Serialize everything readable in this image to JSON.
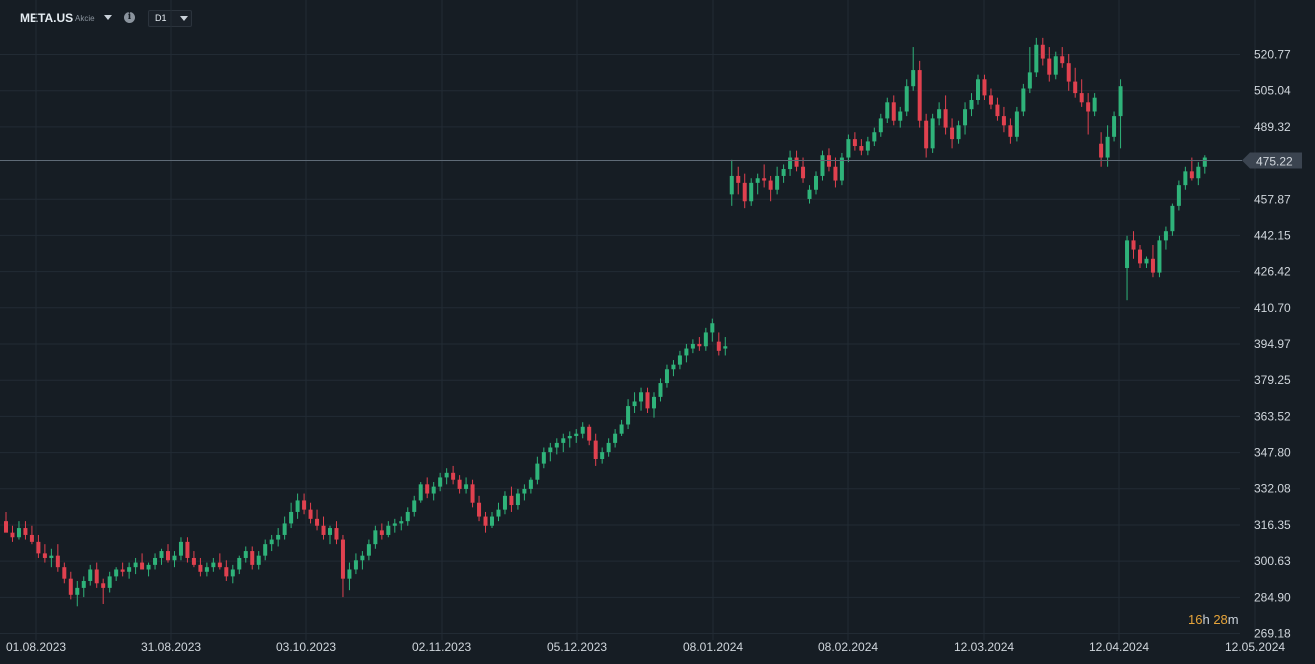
{
  "toolbar": {
    "symbol": "META.US",
    "type": "Akcie",
    "info_icon": "info-icon",
    "timeframe": "D1",
    "dropdown_icon": "chevron-down-icon"
  },
  "countdown": {
    "hours": "16",
    "h": "h",
    "minutes": "28",
    "m": "m"
  },
  "colors": {
    "up": "#2fb37a",
    "down": "#e0414f",
    "background": "#161d24",
    "grid": "#222b34",
    "price_line": "#5f6b77"
  },
  "chart_data": {
    "type": "candlestick",
    "symbol": "META.US",
    "timeframe": "D1",
    "y_ticks": [
      520.77,
      505.04,
      489.32,
      475.22,
      457.87,
      442.15,
      426.42,
      410.7,
      394.97,
      379.25,
      363.52,
      347.8,
      332.08,
      316.35,
      300.63,
      284.9,
      269.18
    ],
    "y_tick_labels": [
      "520.77",
      "505.04",
      "489.32",
      "475.22",
      "457.87",
      "442.15",
      "426.42",
      "410.70",
      "394.97",
      "379.25",
      "363.52",
      "347.80",
      "332.08",
      "316.35",
      "300.63",
      "284.90",
      "269.18"
    ],
    "ylim": [
      269.18,
      520.77
    ],
    "x_ticks": [
      "01.08.2023",
      "31.08.2023",
      "03.10.2023",
      "02.11.2023",
      "05.12.2023",
      "08.01.2024",
      "08.02.2024",
      "12.03.2024",
      "12.04.2024",
      "12.05.2024"
    ],
    "current_price": 475.22,
    "current_price_label": "475.22",
    "candles": [
      [
        318.0,
        322.0,
        316.0,
        313.0
      ],
      [
        313.0,
        316.0,
        309.0,
        311.0
      ],
      [
        311.0,
        318.0,
        310.0,
        315.0
      ],
      [
        315.0,
        318.0,
        310.0,
        312.0
      ],
      [
        312.0,
        316.0,
        308.0,
        309.0
      ],
      [
        309.0,
        312.0,
        302.0,
        304.0
      ],
      [
        304.0,
        308.0,
        300.0,
        302.0
      ],
      [
        302.0,
        306.0,
        298.0,
        303.0
      ],
      [
        303.0,
        308.0,
        296.0,
        298.0
      ],
      [
        298.0,
        300.0,
        291.0,
        293.0
      ],
      [
        293.0,
        296.0,
        284.0,
        286.0
      ],
      [
        286.0,
        292.0,
        281.0,
        289.0
      ],
      [
        289.0,
        294.0,
        285.0,
        292.0
      ],
      [
        292.0,
        299.0,
        290.0,
        297.0
      ],
      [
        297.0,
        300.0,
        289.0,
        291.0
      ],
      [
        291.0,
        293.0,
        282.0,
        289.0
      ],
      [
        289.0,
        296.0,
        287.0,
        294.0
      ],
      [
        294.0,
        298.0,
        292.0,
        297.0
      ],
      [
        297.0,
        300.0,
        294.0,
        296.0
      ],
      [
        296.0,
        300.0,
        293.0,
        298.0
      ],
      [
        298.0,
        302.0,
        295.0,
        300.0
      ],
      [
        300.0,
        304.0,
        297.0,
        297.0
      ],
      [
        297.0,
        300.0,
        294.0,
        299.0
      ],
      [
        299.0,
        304.0,
        297.0,
        302.0
      ],
      [
        302.0,
        306.0,
        299.0,
        305.0
      ],
      [
        305.0,
        308.0,
        300.0,
        301.0
      ],
      [
        301.0,
        305.0,
        298.0,
        303.0
      ],
      [
        303.0,
        311.0,
        301.0,
        309.0
      ],
      [
        309.0,
        311.0,
        300.0,
        302.0
      ],
      [
        302.0,
        305.0,
        298.0,
        299.0
      ],
      [
        299.0,
        302.0,
        294.0,
        296.0
      ],
      [
        296.0,
        300.0,
        294.0,
        298.0
      ],
      [
        298.0,
        302.0,
        296.0,
        300.0
      ],
      [
        300.0,
        304.0,
        297.0,
        298.0
      ],
      [
        298.0,
        301.0,
        292.0,
        294.0
      ],
      [
        294.0,
        299.0,
        291.0,
        297.0
      ],
      [
        297.0,
        303.0,
        295.0,
        302.0
      ],
      [
        302.0,
        307.0,
        300.0,
        305.0
      ],
      [
        305.0,
        307.0,
        297.0,
        299.0
      ],
      [
        299.0,
        305.0,
        297.0,
        303.0
      ],
      [
        303.0,
        310.0,
        301.0,
        308.0
      ],
      [
        308.0,
        312.0,
        305.0,
        310.0
      ],
      [
        310.0,
        315.0,
        307.0,
        312.0
      ],
      [
        312.0,
        320.0,
        310.0,
        317.0
      ],
      [
        317.0,
        326.0,
        315.0,
        322.0
      ],
      [
        322.0,
        330.0,
        319.0,
        327.0
      ],
      [
        327.0,
        330.0,
        321.0,
        323.0
      ],
      [
        323.0,
        326.0,
        317.0,
        319.0
      ],
      [
        319.0,
        323.0,
        314.0,
        316.0
      ],
      [
        316.0,
        320.0,
        310.0,
        312.0
      ],
      [
        312.0,
        316.0,
        308.0,
        315.0
      ],
      [
        315.0,
        318.0,
        308.0,
        310.0
      ],
      [
        310.0,
        312.0,
        285.0,
        293.0
      ],
      [
        293.0,
        300.0,
        288.0,
        297.0
      ],
      [
        297.0,
        304.0,
        295.0,
        301.0
      ],
      [
        301.0,
        305.0,
        297.0,
        303.0
      ],
      [
        303.0,
        310.0,
        301.0,
        308.0
      ],
      [
        308.0,
        316.0,
        306.0,
        314.0
      ],
      [
        314.0,
        317.0,
        310.0,
        312.0
      ],
      [
        312.0,
        318.0,
        311.0,
        316.0
      ],
      [
        316.0,
        319.0,
        313.0,
        317.0
      ],
      [
        317.0,
        320.0,
        314.0,
        318.0
      ],
      [
        318.0,
        324.0,
        316.0,
        322.0
      ],
      [
        322.0,
        329.0,
        320.0,
        327.0
      ],
      [
        327.0,
        335.0,
        326.0,
        334.0
      ],
      [
        334.0,
        337.0,
        328.0,
        330.0
      ],
      [
        330.0,
        335.0,
        327.0,
        333.0
      ],
      [
        333.0,
        339.0,
        331.0,
        337.0
      ],
      [
        337.0,
        341.0,
        334.0,
        339.0
      ],
      [
        339.0,
        342.0,
        334.0,
        336.0
      ],
      [
        336.0,
        338.0,
        330.0,
        332.0
      ],
      [
        332.0,
        337.0,
        330.0,
        334.0
      ],
      [
        334.0,
        336.0,
        324.0,
        326.0
      ],
      [
        326.0,
        329.0,
        318.0,
        320.0
      ],
      [
        320.0,
        322.0,
        313.0,
        316.0
      ],
      [
        316.0,
        322.0,
        315.0,
        320.0
      ],
      [
        320.0,
        326.0,
        318.0,
        323.0
      ],
      [
        323.0,
        331.0,
        321.0,
        329.0
      ],
      [
        329.0,
        333.0,
        322.0,
        325.0
      ],
      [
        325.0,
        332.0,
        323.0,
        330.0
      ],
      [
        330.0,
        334.0,
        327.0,
        332.0
      ],
      [
        332.0,
        337.0,
        330.0,
        336.0
      ],
      [
        336.0,
        346.0,
        334.0,
        343.0
      ],
      [
        343.0,
        350.0,
        341.0,
        348.0
      ],
      [
        348.0,
        352.0,
        344.0,
        350.0
      ],
      [
        350.0,
        354.0,
        347.0,
        352.0
      ],
      [
        352.0,
        356.0,
        348.0,
        354.0
      ],
      [
        354.0,
        357.0,
        350.0,
        355.0
      ],
      [
        355.0,
        358.0,
        352.0,
        356.0
      ],
      [
        356.0,
        361.0,
        354.0,
        359.0
      ],
      [
        359.0,
        360.0,
        351.0,
        353.0
      ],
      [
        353.0,
        356.0,
        342.0,
        345.0
      ],
      [
        345.0,
        350.0,
        343.0,
        348.0
      ],
      [
        348.0,
        354.0,
        346.0,
        352.0
      ],
      [
        352.0,
        358.0,
        350.0,
        356.0
      ],
      [
        356.0,
        362.0,
        355.0,
        360.0
      ],
      [
        360.0,
        371.0,
        358.0,
        368.0
      ],
      [
        368.0,
        374.0,
        365.0,
        370.0
      ],
      [
        370.0,
        376.0,
        366.0,
        374.0
      ],
      [
        374.0,
        376.0,
        365.0,
        367.0
      ],
      [
        367.0,
        374.0,
        363.0,
        372.0
      ],
      [
        372.0,
        380.0,
        370.0,
        378.0
      ],
      [
        378.0,
        386.0,
        376.0,
        384.0
      ],
      [
        384.0,
        388.0,
        381.0,
        386.0
      ],
      [
        386.0,
        392.0,
        384.0,
        390.0
      ],
      [
        390.0,
        395.0,
        387.0,
        393.0
      ],
      [
        393.0,
        397.0,
        391.0,
        395.0
      ],
      [
        395.0,
        398.0,
        392.0,
        394.0
      ],
      [
        394.0,
        402.0,
        392.0,
        400.0
      ],
      [
        400.0,
        406.0,
        396.0,
        404.0
      ],
      [
        396.0,
        400.0,
        390.0,
        392.0
      ],
      [
        393.0,
        398.0,
        390.0,
        394.0
      ],
      [
        460.0,
        475.0,
        455.0,
        468.0
      ],
      [
        468.0,
        472.0,
        460.0,
        465.0
      ],
      [
        465.0,
        469.0,
        454.0,
        457.0
      ],
      [
        457.0,
        467.0,
        455.0,
        465.0
      ],
      [
        465.0,
        469.0,
        460.0,
        467.0
      ],
      [
        467.0,
        473.0,
        463.0,
        466.0
      ],
      [
        466.0,
        468.0,
        457.0,
        462.0
      ],
      [
        462.0,
        472.0,
        460.0,
        468.0
      ],
      [
        468.0,
        473.0,
        465.0,
        471.0
      ],
      [
        471.0,
        479.0,
        468.0,
        476.0
      ],
      [
        476.0,
        479.0,
        470.0,
        472.0
      ],
      [
        472.0,
        476.0,
        465.0,
        467.0
      ],
      [
        458.0,
        464.0,
        456.0,
        462.0
      ],
      [
        462.0,
        470.0,
        460.0,
        468.0
      ],
      [
        468.0,
        479.0,
        466.0,
        477.0
      ],
      [
        477.0,
        480.0,
        470.0,
        472.0
      ],
      [
        472.0,
        476.0,
        463.0,
        466.0
      ],
      [
        466.0,
        478.0,
        464.0,
        476.0
      ],
      [
        476.0,
        486.0,
        474.0,
        484.0
      ],
      [
        484.0,
        487.0,
        479.0,
        481.0
      ],
      [
        481.0,
        484.0,
        477.0,
        479.0
      ],
      [
        479.0,
        485.0,
        477.0,
        483.0
      ],
      [
        483.0,
        489.0,
        481.0,
        487.0
      ],
      [
        487.0,
        495.0,
        485.0,
        493.0
      ],
      [
        493.0,
        502.0,
        491.0,
        500.0
      ],
      [
        500.0,
        503.0,
        490.0,
        492.0
      ],
      [
        492.0,
        498.0,
        489.0,
        496.0
      ],
      [
        496.0,
        510.0,
        494.0,
        507.0
      ],
      [
        507.0,
        524.0,
        505.0,
        514.0
      ],
      [
        514.0,
        518.0,
        489.0,
        492.0
      ],
      [
        492.0,
        495.0,
        476.0,
        480.0
      ],
      [
        480.0,
        495.0,
        478.0,
        493.0
      ],
      [
        493.0,
        500.0,
        490.0,
        497.0
      ],
      [
        497.0,
        503.0,
        486.0,
        489.0
      ],
      [
        489.0,
        493.0,
        480.0,
        484.0
      ],
      [
        484.0,
        492.0,
        482.0,
        490.0
      ],
      [
        490.0,
        500.0,
        486.0,
        497.0
      ],
      [
        497.0,
        504.0,
        494.0,
        501.0
      ],
      [
        501.0,
        512.0,
        499.0,
        510.0
      ],
      [
        510.0,
        512.0,
        501.0,
        503.0
      ],
      [
        503.0,
        506.0,
        497.0,
        499.0
      ],
      [
        499.0,
        502.0,
        492.0,
        494.0
      ],
      [
        494.0,
        498.0,
        487.0,
        490.0
      ],
      [
        490.0,
        493.0,
        482.0,
        485.0
      ],
      [
        485.0,
        498.0,
        483.0,
        496.0
      ],
      [
        496.0,
        508.0,
        494.0,
        506.0
      ],
      [
        506.0,
        524.0,
        504.0,
        513.0
      ],
      [
        513.0,
        528.0,
        511.0,
        525.0
      ],
      [
        525.0,
        528.0,
        516.0,
        519.0
      ],
      [
        519.0,
        524.0,
        509.0,
        512.0
      ],
      [
        512.0,
        522.0,
        510.0,
        520.0
      ],
      [
        520.0,
        524.0,
        515.0,
        517.0
      ],
      [
        517.0,
        521.0,
        505.0,
        509.0
      ],
      [
        509.0,
        515.0,
        502.0,
        504.0
      ],
      [
        504.0,
        510.0,
        498.0,
        500.0
      ],
      [
        500.0,
        504.0,
        486.0,
        496.0
      ],
      [
        496.0,
        504.0,
        494.0,
        502.0
      ],
      [
        482.0,
        487.0,
        472.0,
        476.0
      ],
      [
        476.0,
        490.0,
        472.0,
        485.0
      ],
      [
        485.0,
        496.0,
        483.0,
        494.0
      ],
      [
        494.0,
        510.0,
        480.0,
        507.0
      ],
      [
        428.0,
        442.0,
        414.0,
        440.0
      ],
      [
        440.0,
        444.0,
        432.0,
        436.0
      ],
      [
        436.0,
        438.0,
        428.0,
        430.0
      ],
      [
        430.0,
        433.0,
        428.0,
        432.0
      ],
      [
        432.0,
        438.0,
        424.0,
        426.0
      ],
      [
        426.0,
        442.0,
        424.0,
        440.0
      ],
      [
        440.0,
        446.0,
        436.0,
        444.0
      ],
      [
        444.0,
        456.0,
        442.0,
        455.0
      ],
      [
        455.0,
        466.0,
        453.0,
        464.0
      ],
      [
        464.0,
        472.0,
        462.0,
        470.0
      ],
      [
        470.0,
        476.0,
        466.0,
        467.0
      ],
      [
        467.0,
        474.0,
        464.0,
        472.0
      ],
      [
        472.0,
        477.0,
        469.0,
        476.0
      ]
    ]
  }
}
